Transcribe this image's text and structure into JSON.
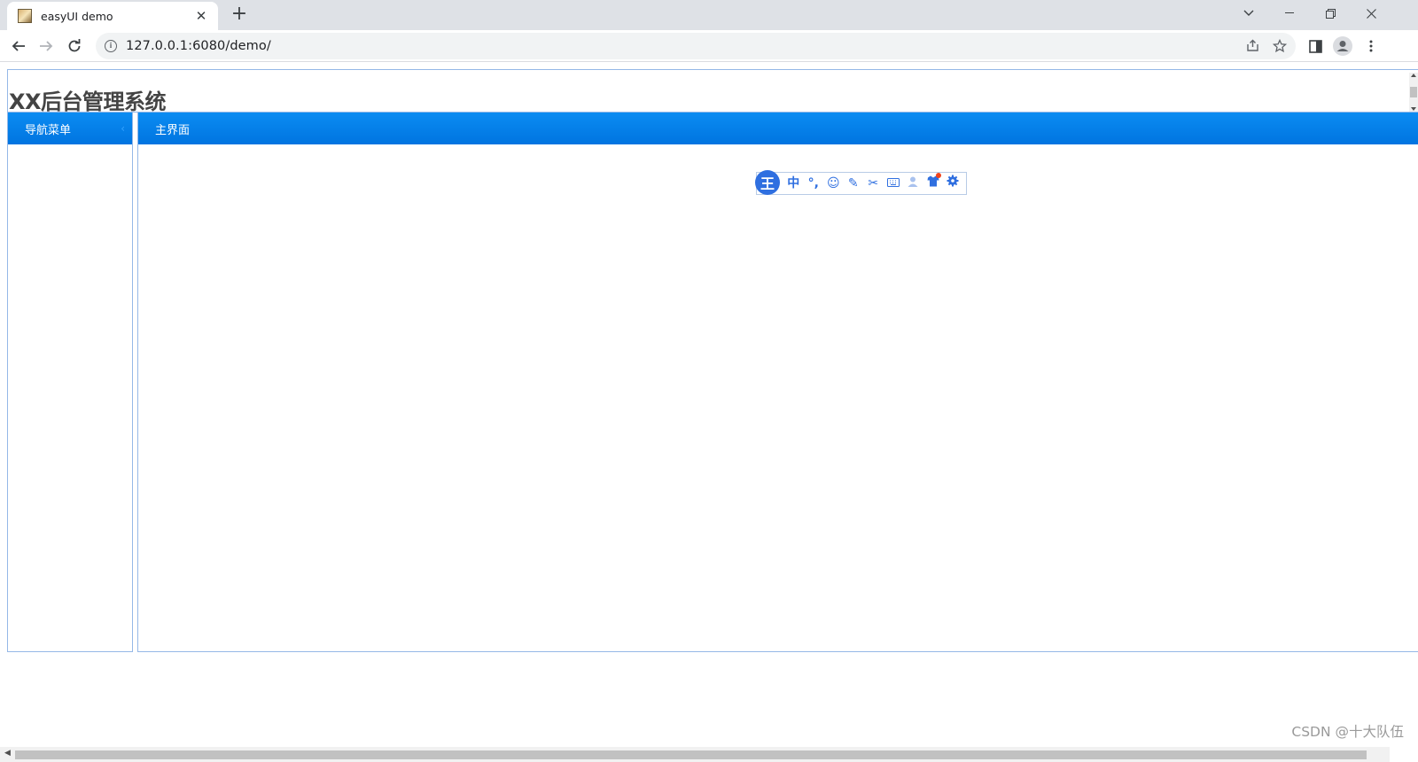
{
  "browser": {
    "tab_title": "easyUI demo",
    "new_tab_glyph": "+",
    "url": "127.0.0.1:6080/demo/"
  },
  "page": {
    "system_title": "XX后台管理系统",
    "west_panel_title": "导航菜单",
    "center_panel_title": "主界面",
    "watermark": "CSDN @十大队伍"
  },
  "ime_toolbar": {
    "logo": "王",
    "mode": "中",
    "icons": [
      "punctuation-icon",
      "emoji-icon",
      "handwriting-icon",
      "screenshot-icon",
      "keyboard-icon",
      "user-icon",
      "skin-icon",
      "settings-icon"
    ]
  },
  "colors": {
    "panel_header": "#0077e6",
    "panel_border": "#95b8e7",
    "title_text": "#444444",
    "ime_blue": "#2f6fe0"
  }
}
